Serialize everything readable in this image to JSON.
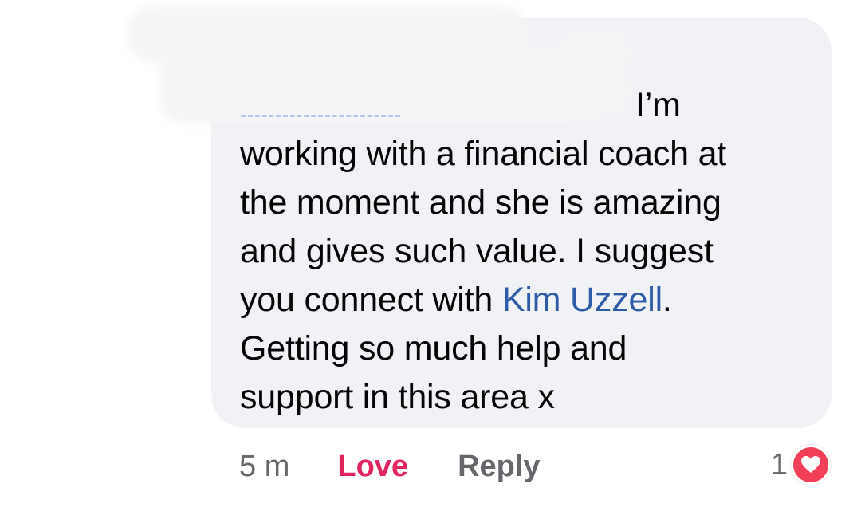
{
  "comment": {
    "mention_name": "Kim Uzzell",
    "lines": [
      "I’m",
      "working with a financial coach at",
      "the moment and she is amazing",
      "and gives such value.  I suggest"
    ],
    "line5_before": "you connect with ",
    "line5_after": ".",
    "lines_end": [
      "Getting so much help and",
      "support in this area x"
    ]
  },
  "actions": {
    "timestamp": "5 m",
    "love_label": "Love",
    "reply_label": "Reply"
  },
  "reactions": {
    "count": "1",
    "icon": "heart-icon",
    "color": "#f33e58"
  },
  "colors": {
    "bubble": "#f0f2f5",
    "mention": "#2e5ba8",
    "love": "#e0245e",
    "muted": "#65676b"
  }
}
